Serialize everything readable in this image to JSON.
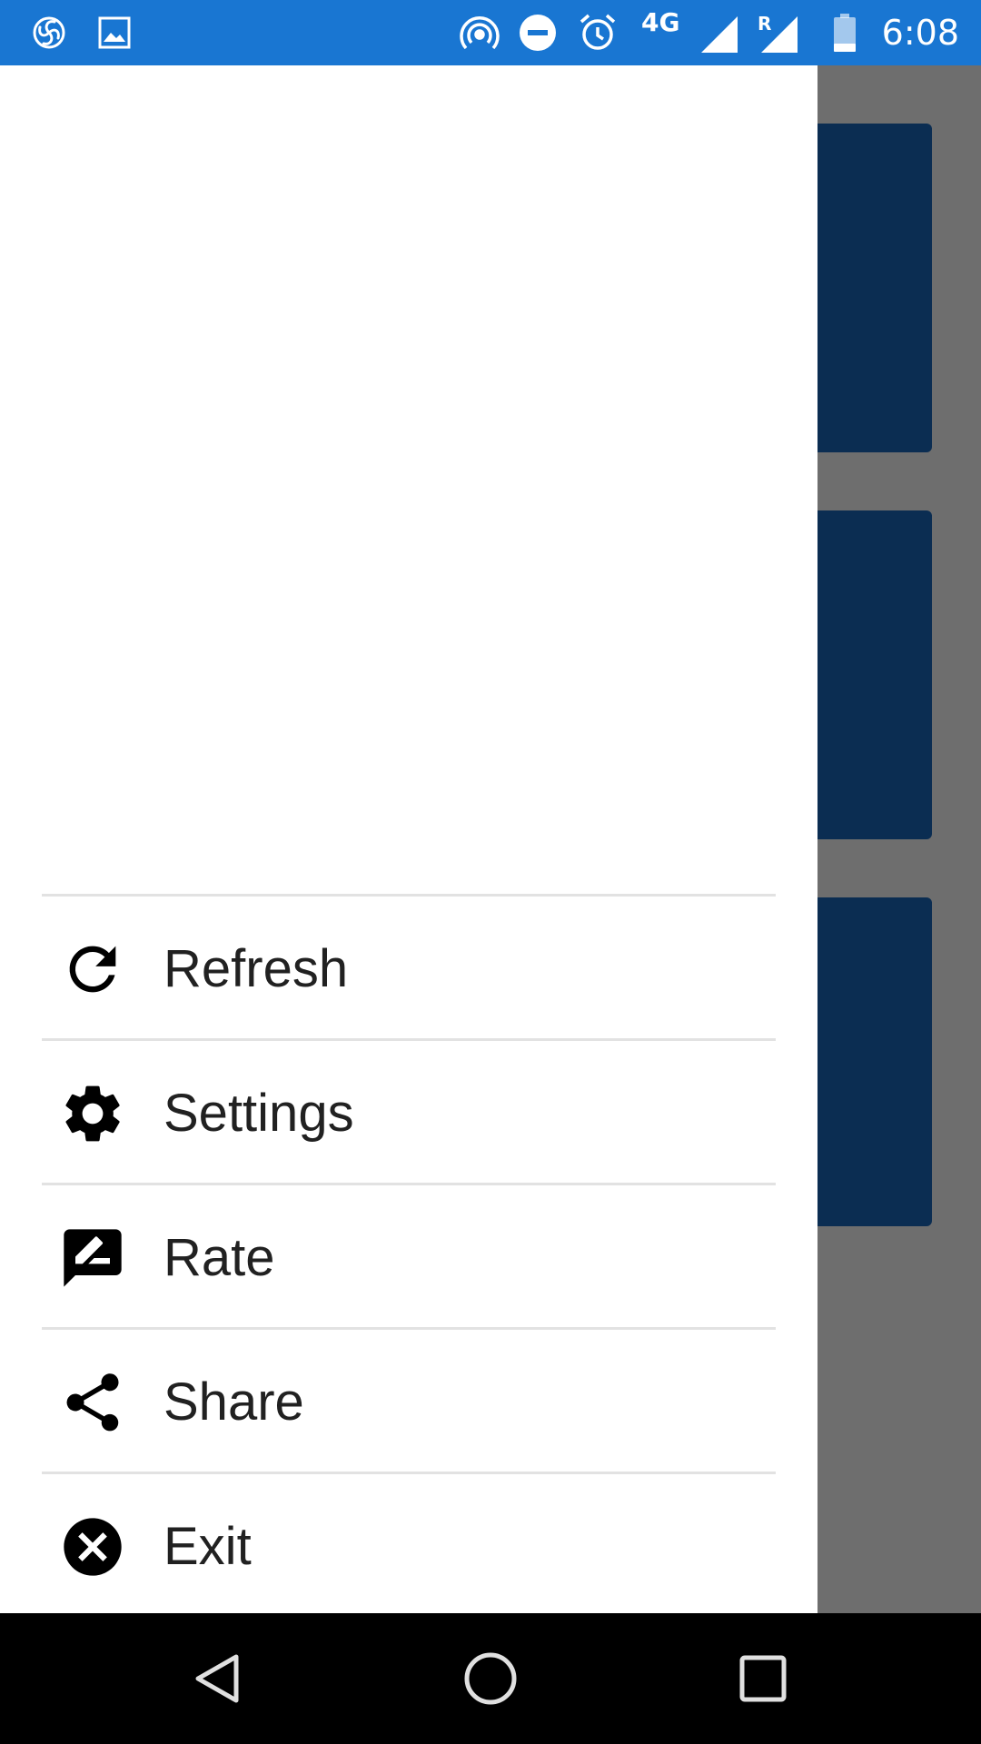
{
  "status_bar": {
    "time": "6:08",
    "network": "4G",
    "roaming": "R",
    "background_color": "#1976d2"
  },
  "drawer": {
    "menu_items": [
      {
        "label": "Refresh",
        "icon": "refresh-icon"
      },
      {
        "label": "Settings",
        "icon": "gear-icon"
      },
      {
        "label": "Rate",
        "icon": "rate-review-icon"
      },
      {
        "label": "Share",
        "icon": "share-icon"
      },
      {
        "label": "Exit",
        "icon": "close-circle-icon"
      }
    ]
  },
  "colors": {
    "card": "#0b2d52",
    "scrim": "#6e6e6e",
    "text": "#212121"
  },
  "nav_bar": {
    "buttons": [
      "back-icon",
      "home-icon",
      "recents-icon"
    ]
  }
}
